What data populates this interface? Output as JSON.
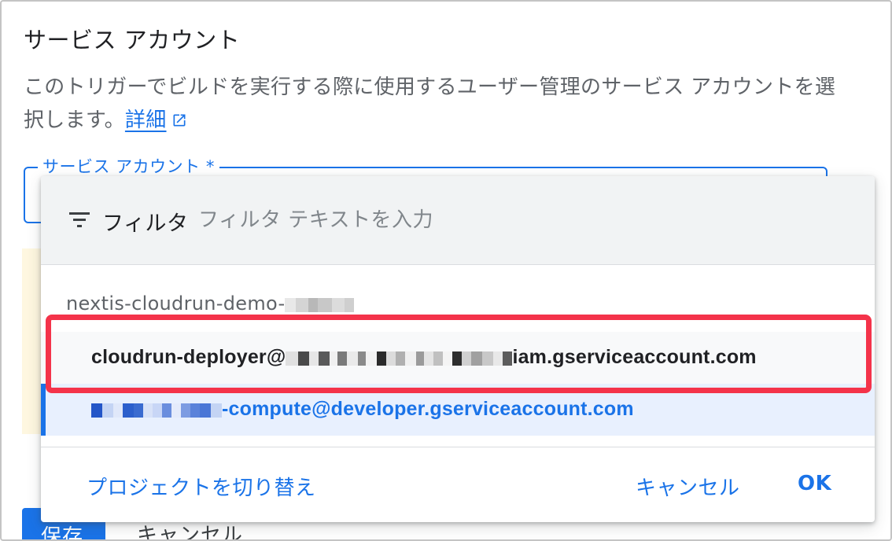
{
  "section": {
    "title": "サービス アカウント",
    "description": "このトリガーでビルドを実行する際に使用するユーザー管理のサービス アカウントを選択します。",
    "learn_more": "詳細"
  },
  "field": {
    "label": "サービス アカウント *"
  },
  "menu": {
    "filter_label": "フィルタ",
    "filter_placeholder": "フィルタ テキストを入力",
    "project_name": "nextis-cloudrun-demo-",
    "options": [
      {
        "prefix": "cloudrun-deployer@",
        "suffix": "iam.gserviceaccount.com"
      },
      {
        "prefix": "",
        "suffix": "-compute@developer.gserviceaccount.com"
      }
    ],
    "switch_project": "プロジェクトを切り替え",
    "cancel": "キャンセル",
    "ok": "OK"
  },
  "footer": {
    "save": "保存",
    "cancel": "キャンセル"
  },
  "colors": {
    "accent": "#1a73e8",
    "highlight": "#f4334a",
    "selected_bg": "#e8f0fe"
  },
  "icons": {
    "filter": "filter-icon",
    "external_link": "external-link-icon"
  }
}
